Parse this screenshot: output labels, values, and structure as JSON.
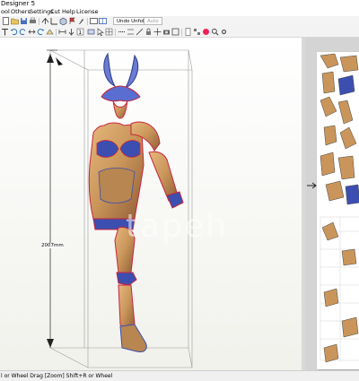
{
  "window": {
    "title": "Designer 5"
  },
  "menu": {
    "items": [
      "ool",
      "Others",
      "Settings",
      "Cut",
      "Help",
      "License"
    ]
  },
  "toolbar": {
    "unfold_label": "Undo Unfold",
    "auto_label": "Auto"
  },
  "view3d": {
    "height_label": "2007mm",
    "watermark": "tapeh"
  },
  "status": {
    "text": "l or Wheel Drag [Zoom] Shift+R or Wheel"
  },
  "colors": {
    "armor_gold": "#c9955a",
    "armor_blue": "#3c4fb0",
    "armor_red": "#c8243c",
    "selection_red": "#d8284a"
  }
}
